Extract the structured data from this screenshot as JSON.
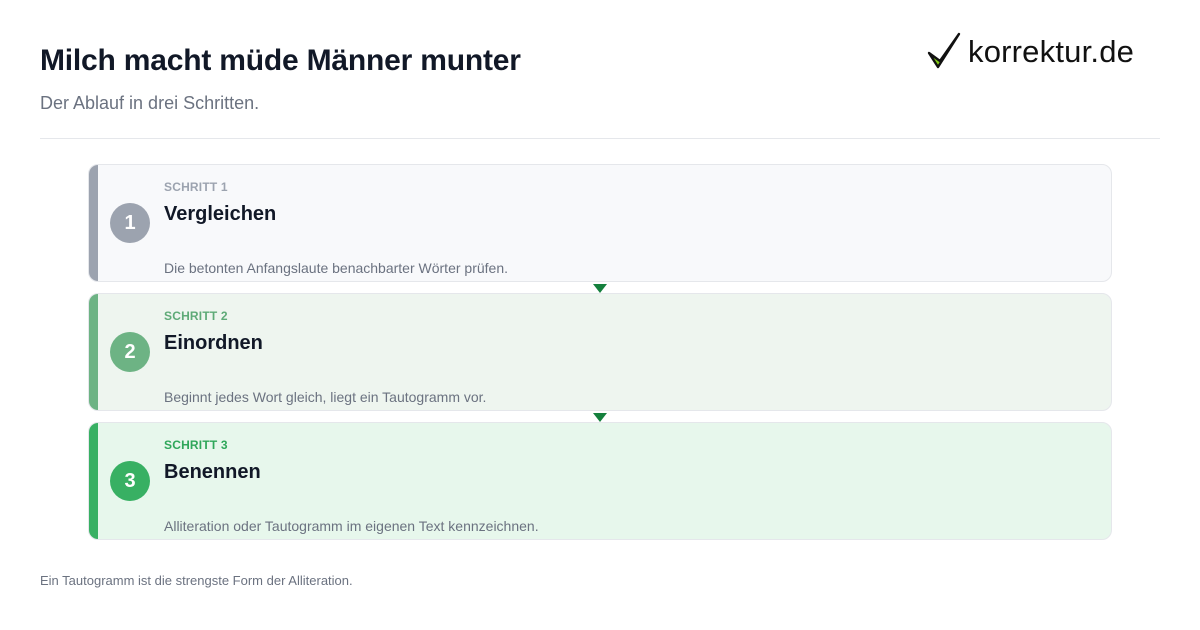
{
  "header": {
    "title": "Milch macht müde Männer munter",
    "subtitle": "Der Ablauf in drei Schritten."
  },
  "logo": {
    "text": "korrektur.de",
    "icon": "checkmark-icon",
    "check_color": "#84cc16",
    "outline_color": "#111111"
  },
  "steps": [
    {
      "number": "1",
      "kicker": "SCHRITT 1",
      "title": "Vergleichen",
      "description": "Die betonten Anfangslaute benachbarter Wörter prüfen.",
      "accent_color": "#9ca3af",
      "kicker_color": "#9ca3af",
      "background_color": "#f8f9fb"
    },
    {
      "number": "2",
      "kicker": "SCHRITT 2",
      "title": "Einordnen",
      "description": "Beginnt jedes Wort gleich, liegt ein Tautogramm vor.",
      "accent_color": "#6db384",
      "kicker_color": "#5eaa77",
      "background_color": "#eef5ef"
    },
    {
      "number": "3",
      "kicker": "SCHRITT 3",
      "title": "Benennen",
      "description": "Alliteration oder Tautogramm im eigenen Text kennzeichnen.",
      "accent_color": "#38b063",
      "kicker_color": "#2fa75a",
      "background_color": "#e7f7ec"
    }
  ],
  "connector_color": "#15803d",
  "footnote": "Ein Tautogramm ist die strengste Form der Alliteration."
}
